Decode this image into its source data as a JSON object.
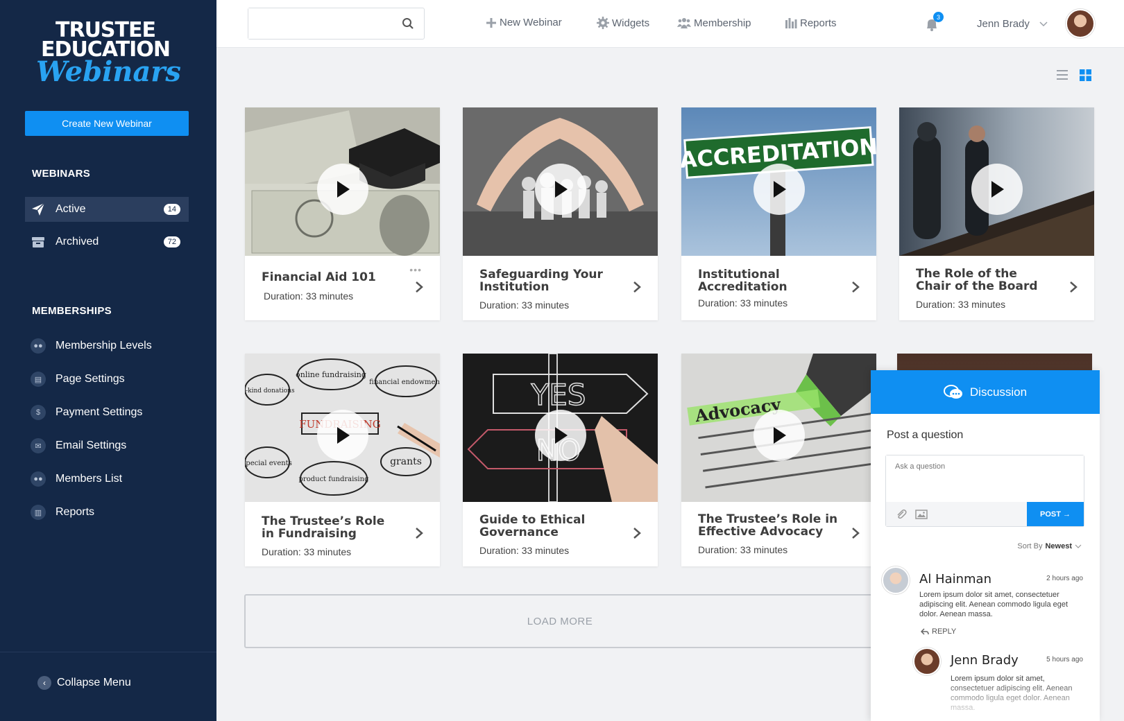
{
  "sidebar": {
    "logo": {
      "line1": "TRUSTEE",
      "line2": "EDUCATION",
      "line3": "Webinars"
    },
    "create_label": "Create New Webinar",
    "webinars_title": "WEBINARS",
    "webinars": [
      {
        "label": "Active",
        "count": "14",
        "icon": "paper-plane-icon"
      },
      {
        "label": "Archived",
        "count": "72",
        "icon": "archive-box-icon"
      }
    ],
    "memberships_title": "MEMBERSHIPS",
    "memberships": [
      {
        "label": "Membership Levels",
        "icon": "users-icon"
      },
      {
        "label": "Page Settings",
        "icon": "page-icon"
      },
      {
        "label": "Payment Settings",
        "icon": "dollar-icon"
      },
      {
        "label": "Email Settings",
        "icon": "envelope-icon"
      },
      {
        "label": "Members List",
        "icon": "users-icon"
      },
      {
        "label": "Reports",
        "icon": "bar-chart-icon"
      }
    ],
    "collapse_label": "Collapse Menu"
  },
  "topbar": {
    "search_placeholder": "",
    "nav": [
      {
        "label": "New Webinar",
        "icon": "plus-icon"
      },
      {
        "label": "Widgets",
        "icon": "gear-icon"
      },
      {
        "label": "Membership",
        "icon": "users-icon"
      },
      {
        "label": "Reports",
        "icon": "bar-chart-icon"
      }
    ],
    "notification_count": "3",
    "user_name": "Jenn Brady"
  },
  "webinars": [
    {
      "title": "Financial Aid 101",
      "duration": "Duration: 33 minutes"
    },
    {
      "title": "Safeguarding Your Institution",
      "duration": "Duration: 33 minutes"
    },
    {
      "title": "Institutional Accreditation",
      "duration": "Duration: 33 minutes"
    },
    {
      "title": "The Role of the Chair of the Board",
      "duration": "Duration: 33 minutes"
    },
    {
      "title": "The Trustee’s Role in Fundraising",
      "duration": "Duration: 33 minutes"
    },
    {
      "title": "Guide to Ethical Governance",
      "duration": "Duration: 33 minutes"
    },
    {
      "title": "The Trustee’s Role in Effective Advocacy",
      "duration": "Duration: 33 minutes"
    }
  ],
  "thumb_text": {
    "accreditation": "ACCREDITATION",
    "yes": "YES",
    "no": "NO",
    "advocacy": "Advocacy",
    "fundraising_words": [
      "online fundraising",
      "financial endowment",
      "in-kind donations",
      "FUNDRAISING",
      "special events",
      "product fundraising",
      "grants"
    ]
  },
  "load_more_label": "LOAD MORE",
  "discussion": {
    "title": "Discussion",
    "post_label": "Post a question",
    "ask_placeholder": "Ask a question",
    "post_button": "POST",
    "sort_prefix": "Sort By",
    "sort_value": "Newest",
    "comments": [
      {
        "name": "Al Hainman",
        "time": "2 hours ago",
        "text": "Lorem ipsum dolor sit amet, consectetuer adipiscing elit. Aenean commodo ligula eget dolor. Aenean massa.",
        "reply_label": "REPLY"
      },
      {
        "name": "Jenn Brady",
        "time": "5 hours ago",
        "text": "Lorem ipsum dolor sit amet, consectetuer adipiscing elit. Aenean commodo ligula eget dolor. Aenean massa."
      }
    ]
  },
  "colors": {
    "sidebar": "#142847",
    "accent": "#0f8ff2",
    "active_item": "#2b3e5e"
  }
}
